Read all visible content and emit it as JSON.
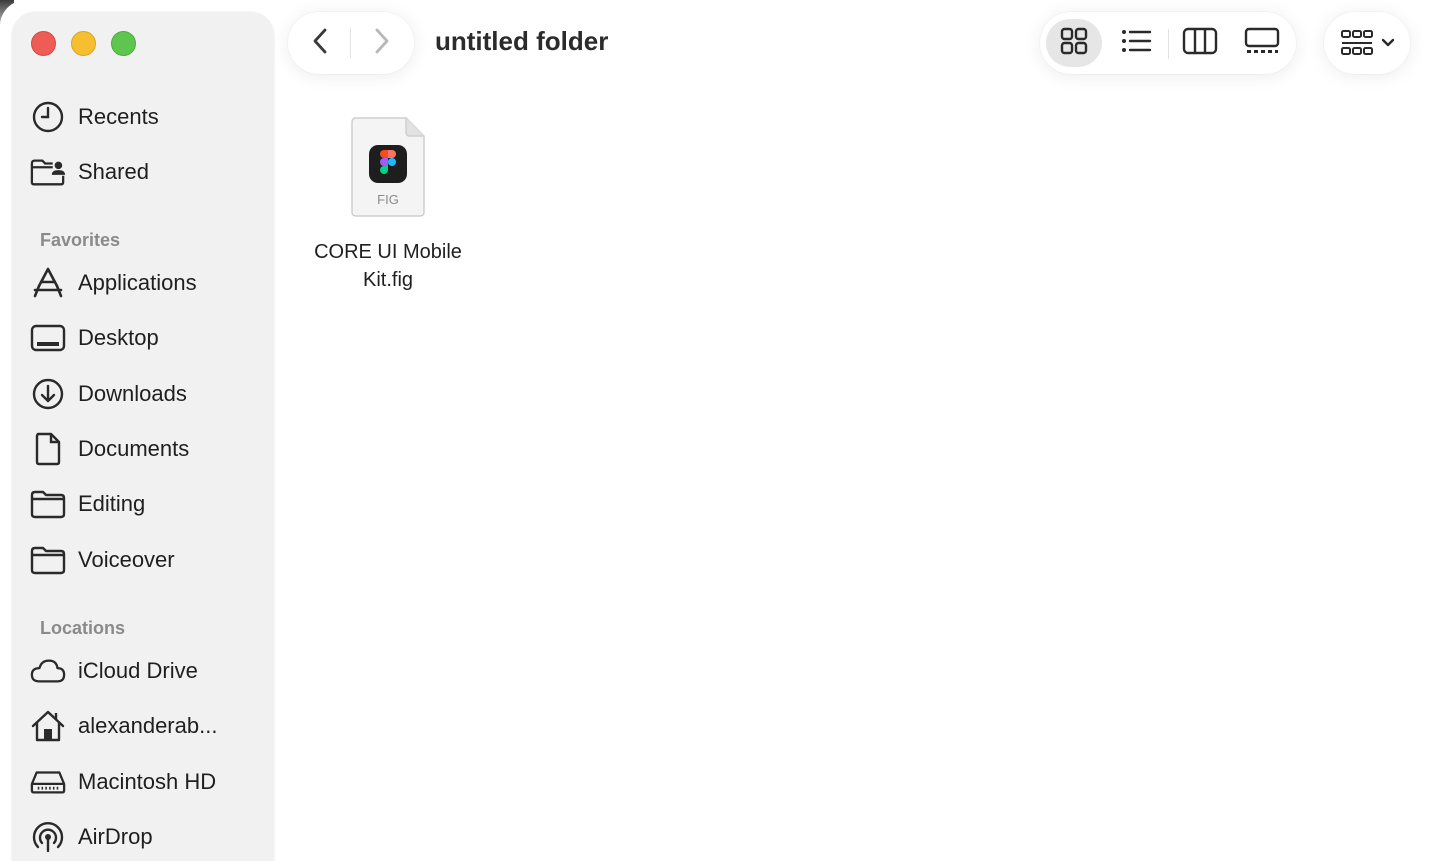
{
  "window": {
    "title": "untitled folder"
  },
  "sidebar": {
    "top_items": [
      {
        "label": "Recents",
        "icon": "clock-icon"
      },
      {
        "label": "Shared",
        "icon": "shared-folder-icon"
      }
    ],
    "favorites_heading": "Favorites",
    "favorites": [
      {
        "label": "Applications",
        "icon": "applications-icon"
      },
      {
        "label": "Desktop",
        "icon": "desktop-icon"
      },
      {
        "label": "Downloads",
        "icon": "downloads-icon"
      },
      {
        "label": "Documents",
        "icon": "document-icon"
      },
      {
        "label": "Editing",
        "icon": "folder-icon"
      },
      {
        "label": "Voiceover",
        "icon": "folder-icon"
      }
    ],
    "locations_heading": "Locations",
    "locations": [
      {
        "label": "iCloud Drive",
        "icon": "cloud-icon"
      },
      {
        "label": "alexanderab...",
        "icon": "home-icon"
      },
      {
        "label": "Macintosh HD",
        "icon": "drive-icon"
      },
      {
        "label": "AirDrop",
        "icon": "airdrop-icon"
      }
    ]
  },
  "toolbar": {
    "view_modes": [
      {
        "name": "icon-view",
        "selected": true
      },
      {
        "name": "list-view",
        "selected": false
      },
      {
        "name": "column-view",
        "selected": false
      },
      {
        "name": "gallery-view",
        "selected": false
      }
    ]
  },
  "files": [
    {
      "name": "CORE UI Mobile Kit.fig",
      "name_line1": "CORE UI Mobile",
      "name_line2": "Kit.fig",
      "type_label": "FIG"
    }
  ],
  "colors": {
    "close": "#ee5c56",
    "minimize": "#f5bf2f",
    "zoom": "#5ec54f",
    "sidebar_bg": "#f1f1f1",
    "section_heading": "#8a8a8a"
  }
}
